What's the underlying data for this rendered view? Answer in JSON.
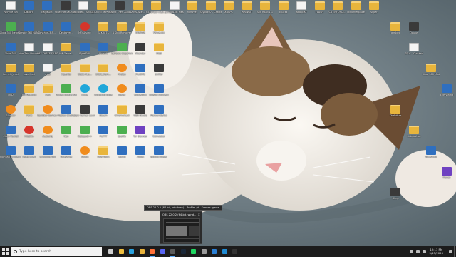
{
  "wallpaper": {
    "subject": "",
    "colors": {
      "fabric": "#6f7e86",
      "fur_white": "#f3efe9",
      "fur_brown": "#7b5c3d",
      "nose": "#e9a1a1"
    }
  },
  "desktop": {
    "icons": [
      {
        "label": "Recycle Bin",
        "kind": "doc"
      },
      {
        "label": "Discord",
        "kind": "app"
      },
      {
        "label": "EagleGet",
        "kind": "app"
      },
      {
        "label": "Minecraft Launcher",
        "kind": "game"
      },
      {
        "label": "unicode8 - Shortcut",
        "kind": "doc"
      },
      {
        "label": "CLICK ME IMPORTANT",
        "kind": "folder"
      },
      {
        "label": "Grand Theft Auto V",
        "kind": "game"
      },
      {
        "label": "DOvs-Alter...",
        "kind": "folder"
      },
      {
        "label": "C52shoul-matr...",
        "kind": "folder"
      },
      {
        "label": "window.txt files",
        "kind": "doc"
      },
      {
        "label": "hammer",
        "kind": "folder"
      },
      {
        "label": "Skybox07 - Cracked",
        "kind": "folder"
      },
      {
        "label": "XDRPC",
        "kind": "folder"
      },
      {
        "label": "WREWXT",
        "kind": "folder"
      },
      {
        "label": "Silk Road 1.1",
        "kind": "folder"
      },
      {
        "label": "chuckz",
        "kind": "folder"
      },
      {
        "label": "webTEXT",
        "kind": "doc"
      },
      {
        "label": "FLASH",
        "kind": "folder"
      },
      {
        "label": "CB ENFORCE...",
        "kind": "folder"
      },
      {
        "label": "ckMarketplace",
        "kind": "folder"
      },
      {
        "label": "super",
        "kind": "folder"
      },
      {
        "label": "Xbox 360 Neighborh...",
        "kind": "green"
      },
      {
        "label": "Simple 360 NAND Fl...",
        "kind": "app"
      },
      {
        "label": "python-3.8...",
        "kind": "app"
      },
      {
        "label": "Destroyer...",
        "kind": "app"
      },
      {
        "label": "MEGAsync",
        "kind": "red"
      },
      {
        "label": "SEKRETS",
        "kind": "folder"
      },
      {
        "label": "aimbot",
        "kind": "folder"
      },
      {
        "label": "4 Skill Remover",
        "kind": "folder"
      },
      {
        "label": "FBHAXS",
        "kind": "folder"
      },
      {
        "label": "Visual-Ex",
        "kind": "folder"
      },
      {
        "label": "Xbox 360",
        "kind": "app"
      },
      {
        "label": "New Text Document...",
        "kind": "doc"
      },
      {
        "label": "USE THESE FILES FOR B...",
        "kind": "doc"
      },
      {
        "label": "SFLC - Cracked",
        "kind": "doc"
      },
      {
        "label": "VM-Game...",
        "kind": "folder"
      },
      {
        "label": "Byte Edit",
        "kind": "app"
      },
      {
        "label": "Ubisoft",
        "kind": "app"
      },
      {
        "label": "GeForce Experience",
        "kind": "green"
      },
      {
        "label": "Xsender",
        "kind": "game"
      },
      {
        "label": "RGB",
        "kind": "folder"
      },
      {
        "label": "Xbox 360 Mod",
        "kind": "folder"
      },
      {
        "label": "kernels_mod",
        "kind": "folder"
      },
      {
        "label": "Java Mod",
        "kind": "folder"
      },
      {
        "label": "mge",
        "kind": "doc"
      },
      {
        "label": "AquaTec",
        "kind": "folder"
      },
      {
        "label": "USBC-Ava...",
        "kind": "folder"
      },
      {
        "label": "USBC_Rem...",
        "kind": "folder"
      },
      {
        "label": "Everything",
        "kind": "app"
      },
      {
        "label": "Firefox",
        "kind": "orange"
      },
      {
        "label": "MultiMC",
        "kind": "app"
      },
      {
        "label": "Sniffer",
        "kind": "game"
      },
      {
        "label": "HxD",
        "kind": "app"
      },
      {
        "label": "BD Desktop",
        "kind": "folder"
      },
      {
        "label": "wiiu",
        "kind": "folder"
      },
      {
        "label": "TheEditor",
        "kind": "folder"
      },
      {
        "label": "Scaleu Sketch Server",
        "kind": "green"
      },
      {
        "label": "Edge",
        "kind": "cyan"
      },
      {
        "label": "Microsoft Edge",
        "kind": "cyan"
      },
      {
        "label": "Brave",
        "kind": "orange"
      },
      {
        "label": "VirtualBox",
        "kind": "app"
      },
      {
        "label": "Ubisoft Connect",
        "kind": "app"
      },
      {
        "label": "Subnautica",
        "kind": "folder"
      },
      {
        "label": "Blender",
        "kind": "orange"
      },
      {
        "label": "Paint",
        "kind": "folder"
      },
      {
        "label": "Rockstar Games Launcher",
        "kind": "orange"
      },
      {
        "label": "Roblox Studio",
        "kind": "app"
      },
      {
        "label": "Epic Games Launcher",
        "kind": "game"
      },
      {
        "label": "Steam",
        "kind": "app"
      },
      {
        "label": "Wireshark",
        "kind": "app"
      },
      {
        "label": "ChromeCast",
        "kind": "folder"
      },
      {
        "label": "OBS Studio",
        "kind": "game"
      },
      {
        "label": "Malwarebytes",
        "kind": "app"
      },
      {
        "label": "Cisco Packet",
        "kind": "app"
      },
      {
        "label": "FileZilla",
        "kind": "red"
      },
      {
        "label": "Audacity",
        "kind": "orange"
      },
      {
        "label": "iTunes",
        "kind": "purple"
      },
      {
        "label": "Nox",
        "kind": "green"
      },
      {
        "label": "Notepad++",
        "kind": "green"
      },
      {
        "label": "PuTTY",
        "kind": "app"
      },
      {
        "label": "Spotify",
        "kind": "green"
      },
      {
        "label": "Tor Browser",
        "kind": "purple"
      },
      {
        "label": "Calculator",
        "kind": "app"
      },
      {
        "label": "Gimp",
        "kind": "game"
      },
      {
        "label": "Mozilla Thunderbird",
        "kind": "app"
      },
      {
        "label": "Open Shell",
        "kind": "app"
      },
      {
        "label": "Snipping Tool",
        "kind": "app"
      },
      {
        "label": "OneDrive",
        "kind": "app"
      },
      {
        "label": "Origin",
        "kind": "orange"
      },
      {
        "label": "OBS Tools",
        "kind": "folder"
      },
      {
        "label": "Oculus",
        "kind": "game"
      },
      {
        "label": "Lghub",
        "kind": "app"
      },
      {
        "label": "Zoom",
        "kind": "app"
      },
      {
        "label": "Roblox Player",
        "kind": "app"
      }
    ]
  },
  "taskbar_preview": {
    "tooltip": "OBS 22.0.2 (64-bit, windows) - Profile: yt - Scenes: game",
    "title": "OBS 22.0.2 (64-bit, wind...",
    "close_glyph": "×"
  },
  "taskbar": {
    "search_placeholder": "Type here to search",
    "apps": [
      {
        "name": "task-view",
        "color": "#cfcfcf",
        "active": false
      },
      {
        "name": "file-explorer",
        "color": "#f0c040",
        "active": false
      },
      {
        "name": "edge",
        "color": "#2aa3e0",
        "active": false
      },
      {
        "name": "chrome",
        "color": "#e8b23a",
        "active": false
      },
      {
        "name": "firefox",
        "color": "#ff7139",
        "active": true
      },
      {
        "name": "discord",
        "color": "#5865f2",
        "active": false
      },
      {
        "name": "obs",
        "color": "#5a5a5a",
        "active": true
      },
      {
        "name": "steam",
        "color": "#1b2838",
        "active": false
      },
      {
        "name": "spotify",
        "color": "#1ed760",
        "active": false
      },
      {
        "name": "store",
        "color": "#9a9a9a",
        "active": false
      },
      {
        "name": "mail",
        "color": "#2a7fd4",
        "active": false
      },
      {
        "name": "vscode",
        "color": "#1f8ad2",
        "active": false
      },
      {
        "name": "terminal",
        "color": "#333333",
        "active": false
      }
    ],
    "clock_time": "12:11 PM",
    "clock_date": "5/25/2020"
  }
}
